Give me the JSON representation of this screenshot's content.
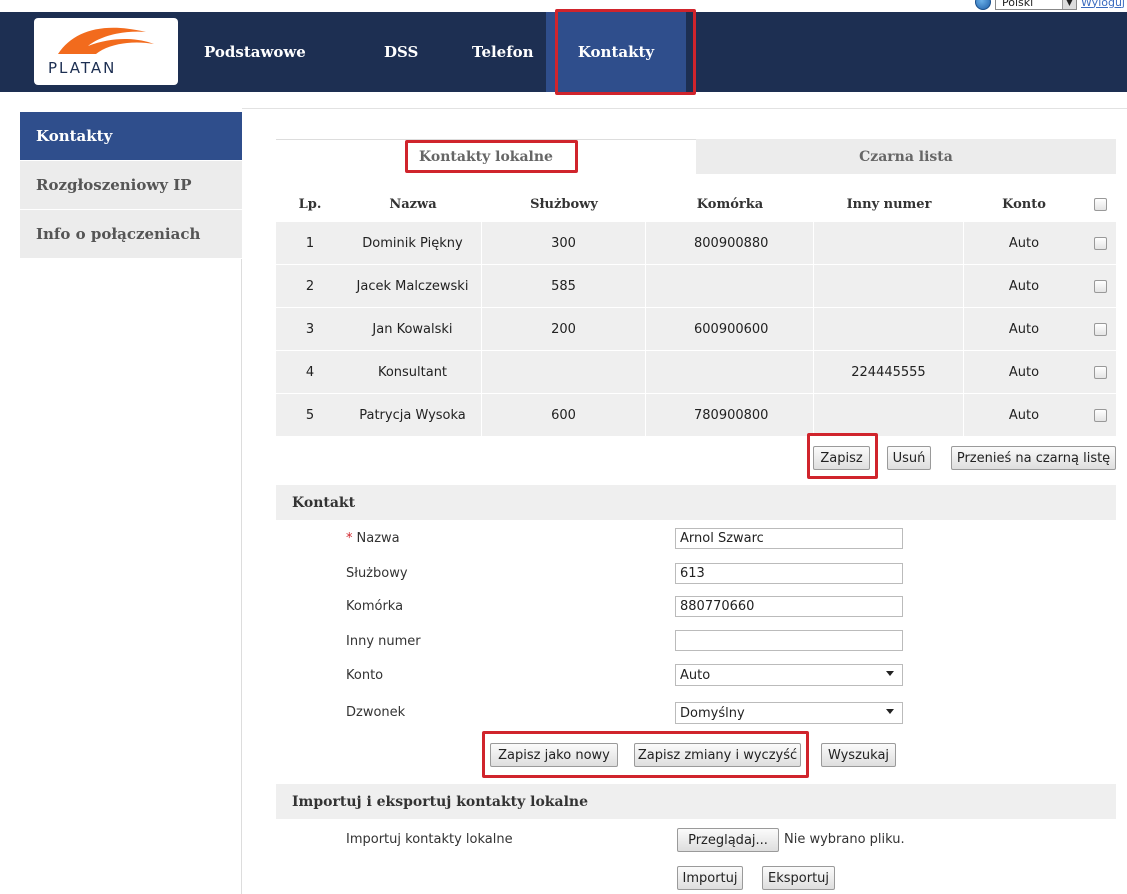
{
  "top": {
    "language": "Polski",
    "logout": "Wyloguj"
  },
  "header": {
    "logo_text": "PLATAN",
    "nav": [
      "Podstawowe",
      "DSS",
      "Telefon",
      "Kontakty"
    ]
  },
  "sidebar": {
    "items": [
      {
        "label": "Kontakty"
      },
      {
        "label": "Rozgłoszeniowy IP"
      },
      {
        "label": "Info o połączeniach"
      }
    ]
  },
  "tabs": {
    "local": "Kontakty lokalne",
    "blacklist": "Czarna lista"
  },
  "table": {
    "headers": {
      "lp": "Lp.",
      "name": "Nazwa",
      "work": "Służbowy",
      "mobile": "Komórka",
      "other": "Inny numer",
      "account": "Konto"
    },
    "rows": [
      {
        "lp": "1",
        "name": "Dominik Piękny",
        "work": "300",
        "mobile": "800900880",
        "other": "",
        "account": "Auto"
      },
      {
        "lp": "2",
        "name": "Jacek Malczewski",
        "work": "585",
        "mobile": "",
        "other": "",
        "account": "Auto"
      },
      {
        "lp": "3",
        "name": "Jan Kowalski",
        "work": "200",
        "mobile": "600900600",
        "other": "",
        "account": "Auto"
      },
      {
        "lp": "4",
        "name": "Konsultant",
        "work": "",
        "mobile": "",
        "other": "224445555",
        "account": "Auto"
      },
      {
        "lp": "5",
        "name": "Patrycja Wysoka",
        "work": "600",
        "mobile": "780900800",
        "other": "",
        "account": "Auto"
      }
    ]
  },
  "table_buttons": {
    "save": "Zapisz",
    "delete": "Usuń",
    "move": "Przenieś na czarną listę"
  },
  "contact": {
    "title": "Kontakt",
    "required_mark": "*",
    "labels": {
      "name": "Nazwa",
      "work": "Służbowy",
      "mobile": "Komórka",
      "other": "Inny numer",
      "account": "Konto",
      "ring": "Dzwonek"
    },
    "values": {
      "name": "Arnol Szwarc",
      "work": "613",
      "mobile": "880770660",
      "other": "",
      "account": "Auto",
      "ring": "Domyślny"
    },
    "buttons": {
      "save_new": "Zapisz jako nowy",
      "save_clear": "Zapisz zmiany i wyczyść",
      "search": "Wyszukaj"
    }
  },
  "import": {
    "title": "Importuj i eksportuj kontakty lokalne",
    "label": "Importuj kontakty lokalne",
    "browse": "Przeglądaj...",
    "no_file": "Nie wybrano pliku.",
    "import_btn": "Importuj",
    "export_btn": "Eksportuj"
  },
  "colors": {
    "header_bg": "#1d2f52",
    "active_nav": "#2f4e8c",
    "highlight": "#d0242c",
    "logo_orange": "#f26b1d"
  }
}
